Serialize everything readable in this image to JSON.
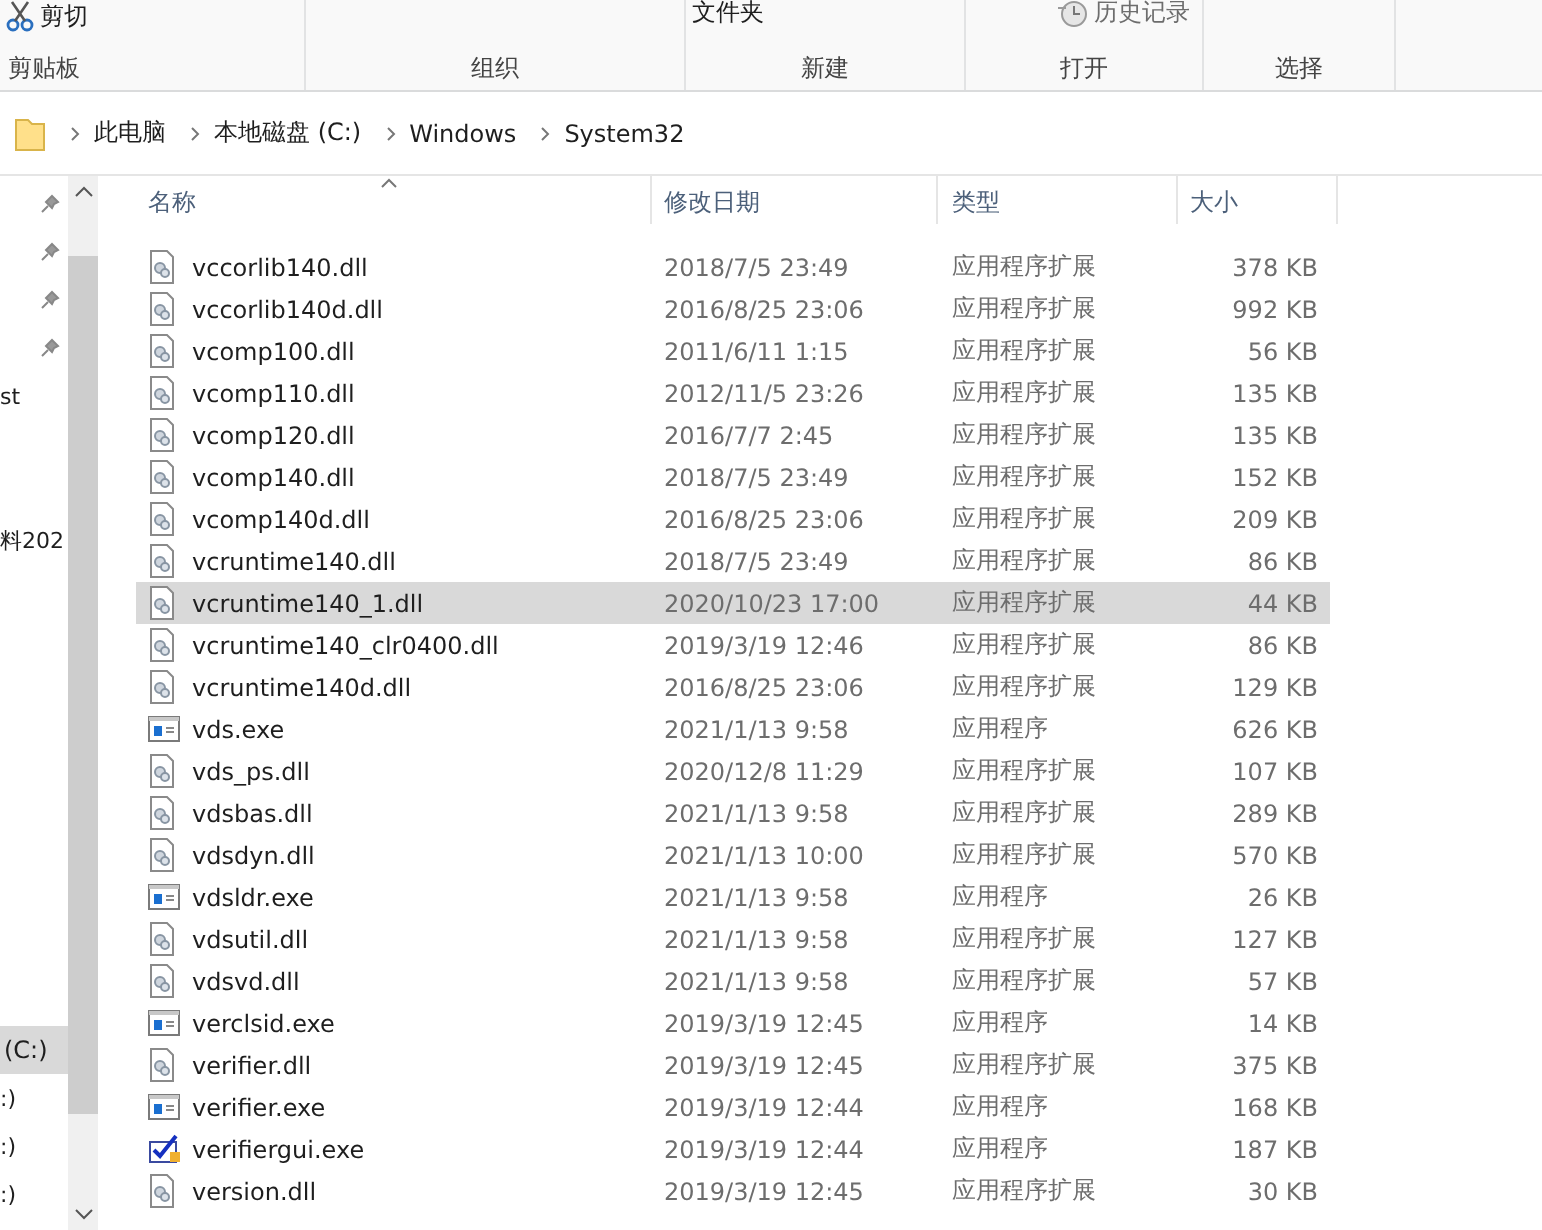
{
  "ribbon": {
    "groups": [
      {
        "label": "剪贴板",
        "items": [
          {
            "text": "剪切",
            "kind": "cut"
          }
        ]
      },
      {
        "label": "组织"
      },
      {
        "label": "新建",
        "items": [
          {
            "text": "文件夹",
            "kind": "plain"
          }
        ]
      },
      {
        "label": "打开",
        "items": [
          {
            "text": "历史记录",
            "kind": "history"
          }
        ]
      },
      {
        "label": "选择"
      }
    ]
  },
  "address": {
    "crumbs": [
      "此电脑",
      "本地磁盘 (C:)",
      "Windows",
      "System32"
    ]
  },
  "nav": {
    "quick": [
      {
        "pinned": true
      },
      {
        "pinned": true
      },
      {
        "pinned": true
      },
      {
        "pinned": true
      },
      {
        "text": "st",
        "pinned": false
      },
      {
        "text": "料202",
        "pinned": false
      }
    ],
    "drives": [
      {
        "text": "(C:)",
        "selected": true
      },
      {
        "text": ":)",
        "selected": false
      },
      {
        "text": ":)",
        "selected": false
      },
      {
        "text": ":)",
        "selected": false
      }
    ]
  },
  "table": {
    "columns": [
      "名称",
      "修改日期",
      "类型",
      "大小"
    ],
    "rows": [
      {
        "name": "vccorlib140.dll",
        "date": "2018/7/5 23:49",
        "type": "应用程序扩展",
        "size": "378 KB",
        "kind": "dll",
        "selected": false
      },
      {
        "name": "vccorlib140d.dll",
        "date": "2016/8/25 23:06",
        "type": "应用程序扩展",
        "size": "992 KB",
        "kind": "dll",
        "selected": false
      },
      {
        "name": "vcomp100.dll",
        "date": "2011/6/11 1:15",
        "type": "应用程序扩展",
        "size": "56 KB",
        "kind": "dll",
        "selected": false
      },
      {
        "name": "vcomp110.dll",
        "date": "2012/11/5 23:26",
        "type": "应用程序扩展",
        "size": "135 KB",
        "kind": "dll",
        "selected": false
      },
      {
        "name": "vcomp120.dll",
        "date": "2016/7/7 2:45",
        "type": "应用程序扩展",
        "size": "135 KB",
        "kind": "dll",
        "selected": false
      },
      {
        "name": "vcomp140.dll",
        "date": "2018/7/5 23:49",
        "type": "应用程序扩展",
        "size": "152 KB",
        "kind": "dll",
        "selected": false
      },
      {
        "name": "vcomp140d.dll",
        "date": "2016/8/25 23:06",
        "type": "应用程序扩展",
        "size": "209 KB",
        "kind": "dll",
        "selected": false
      },
      {
        "name": "vcruntime140.dll",
        "date": "2018/7/5 23:49",
        "type": "应用程序扩展",
        "size": "86 KB",
        "kind": "dll",
        "selected": false
      },
      {
        "name": "vcruntime140_1.dll",
        "date": "2020/10/23 17:00",
        "type": "应用程序扩展",
        "size": "44 KB",
        "kind": "dll",
        "selected": true
      },
      {
        "name": "vcruntime140_clr0400.dll",
        "date": "2019/3/19 12:46",
        "type": "应用程序扩展",
        "size": "86 KB",
        "kind": "dll",
        "selected": false
      },
      {
        "name": "vcruntime140d.dll",
        "date": "2016/8/25 23:06",
        "type": "应用程序扩展",
        "size": "129 KB",
        "kind": "dll",
        "selected": false
      },
      {
        "name": "vds.exe",
        "date": "2021/1/13 9:58",
        "type": "应用程序",
        "size": "626 KB",
        "kind": "exe",
        "selected": false
      },
      {
        "name": "vds_ps.dll",
        "date": "2020/12/8 11:29",
        "type": "应用程序扩展",
        "size": "107 KB",
        "kind": "dll",
        "selected": false
      },
      {
        "name": "vdsbas.dll",
        "date": "2021/1/13 9:58",
        "type": "应用程序扩展",
        "size": "289 KB",
        "kind": "dll",
        "selected": false
      },
      {
        "name": "vdsdyn.dll",
        "date": "2021/1/13 10:00",
        "type": "应用程序扩展",
        "size": "570 KB",
        "kind": "dll",
        "selected": false
      },
      {
        "name": "vdsldr.exe",
        "date": "2021/1/13 9:58",
        "type": "应用程序",
        "size": "26 KB",
        "kind": "exe",
        "selected": false
      },
      {
        "name": "vdsutil.dll",
        "date": "2021/1/13 9:58",
        "type": "应用程序扩展",
        "size": "127 KB",
        "kind": "dll",
        "selected": false
      },
      {
        "name": "vdsvd.dll",
        "date": "2021/1/13 9:58",
        "type": "应用程序扩展",
        "size": "57 KB",
        "kind": "dll",
        "selected": false
      },
      {
        "name": "verclsid.exe",
        "date": "2019/3/19 12:45",
        "type": "应用程序",
        "size": "14 KB",
        "kind": "exe",
        "selected": false
      },
      {
        "name": "verifier.dll",
        "date": "2019/3/19 12:45",
        "type": "应用程序扩展",
        "size": "375 KB",
        "kind": "dll",
        "selected": false
      },
      {
        "name": "verifier.exe",
        "date": "2019/3/19 12:44",
        "type": "应用程序",
        "size": "168 KB",
        "kind": "exe",
        "selected": false
      },
      {
        "name": "verifiergui.exe",
        "date": "2019/3/19 12:44",
        "type": "应用程序",
        "size": "187 KB",
        "kind": "gui",
        "selected": false
      },
      {
        "name": "version.dll",
        "date": "2019/3/19 12:45",
        "type": "应用程序扩展",
        "size": "30 KB",
        "kind": "dll",
        "selected": false
      }
    ]
  }
}
